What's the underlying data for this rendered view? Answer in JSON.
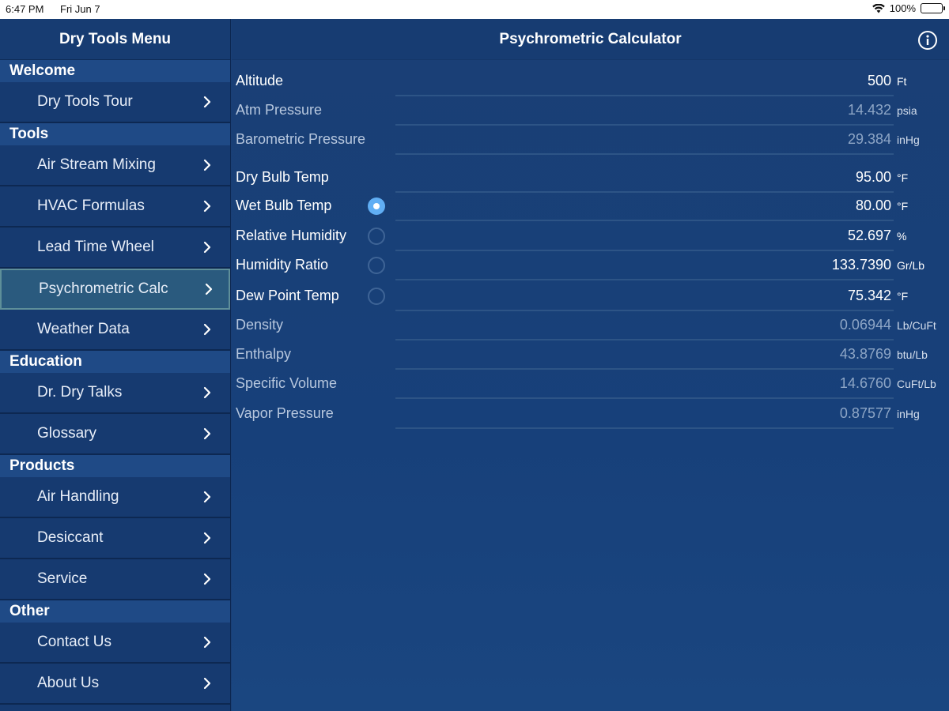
{
  "status_bar": {
    "time": "6:47 PM",
    "date": "Fri Jun 7",
    "battery": "100%"
  },
  "sidebar": {
    "title": "Dry Tools Menu",
    "sections": [
      {
        "title": "Welcome",
        "items": [
          {
            "label": "Dry Tools Tour"
          }
        ]
      },
      {
        "title": "Tools",
        "items": [
          {
            "label": "Air Stream Mixing"
          },
          {
            "label": "HVAC Formulas"
          },
          {
            "label": "Lead Time Wheel"
          },
          {
            "label": "Psychrometric Calc",
            "selected": true
          },
          {
            "label": "Weather Data"
          }
        ]
      },
      {
        "title": "Education",
        "items": [
          {
            "label": "Dr. Dry Talks"
          },
          {
            "label": "Glossary"
          }
        ]
      },
      {
        "title": "Products",
        "items": [
          {
            "label": "Air Handling"
          },
          {
            "label": "Desiccant"
          },
          {
            "label": "Service"
          }
        ]
      },
      {
        "title": "Other",
        "items": [
          {
            "label": "Contact Us"
          },
          {
            "label": "About Us"
          }
        ]
      }
    ]
  },
  "main": {
    "title": "Psychrometric Calculator",
    "fields": [
      {
        "label": "Altitude",
        "value": "500",
        "unit": "Ft",
        "editable": true
      },
      {
        "label": "Atm Pressure",
        "value": "14.432",
        "unit": "psia",
        "editable": false
      },
      {
        "label": "Barometric Pressure",
        "value": "29.384",
        "unit": "inHg",
        "editable": false
      },
      {
        "label": "Dry Bulb Temp",
        "value": "95.00",
        "unit": "°F",
        "editable": true
      },
      {
        "label": "Wet Bulb Temp",
        "value": "80.00",
        "unit": "°F",
        "editable": true,
        "radio": "selected"
      },
      {
        "label": "Relative Humidity",
        "value": "52.697",
        "unit": "%",
        "editable": true,
        "radio": "unselected"
      },
      {
        "label": "Humidity Ratio",
        "value": "133.7390",
        "unit": "Gr/Lb",
        "editable": true,
        "radio": "unselected"
      },
      {
        "label": "Dew Point Temp",
        "value": "75.342",
        "unit": "°F",
        "editable": true,
        "radio": "unselected"
      },
      {
        "label": "Density",
        "value": "0.06944",
        "unit": "Lb/CuFt",
        "editable": false
      },
      {
        "label": "Enthalpy",
        "value": "43.8769",
        "unit": "btu/Lb",
        "editable": false
      },
      {
        "label": "Specific Volume",
        "value": "14.6760",
        "unit": "CuFt/Lb",
        "editable": false
      },
      {
        "label": "Vapor Pressure",
        "value": "0.87577",
        "unit": "inHg",
        "editable": false
      }
    ]
  },
  "icons": {
    "chevron": "chevron-right-icon",
    "info": "info-icon",
    "wifi": "wifi-icon",
    "battery": "battery-icon"
  },
  "colors": {
    "radio_selected": "#60aef4",
    "background": "#1a3f75",
    "section_header": "#1f4a86"
  }
}
